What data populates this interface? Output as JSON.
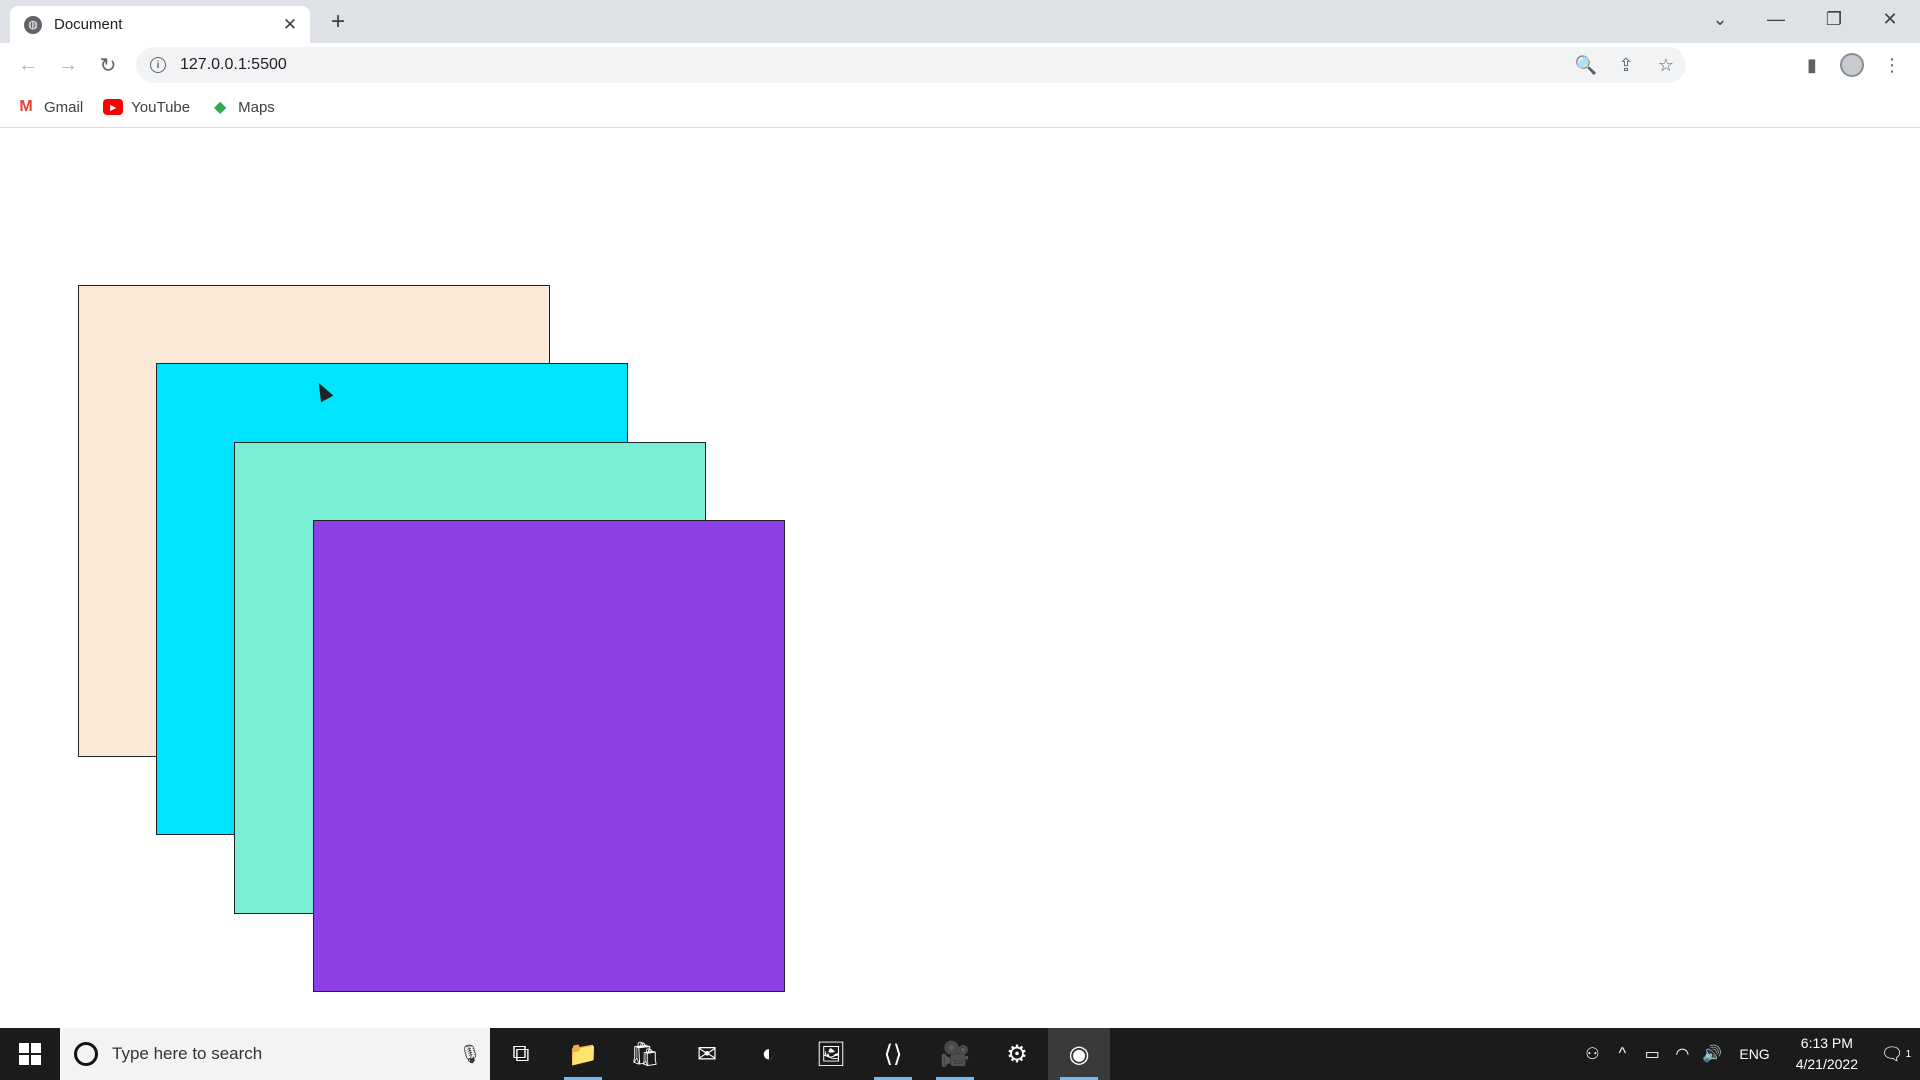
{
  "browser": {
    "tab": {
      "title": "Document",
      "close": "✕"
    },
    "new_tab": "+",
    "window_controls": {
      "tablist": "⌄",
      "minimize": "—",
      "restore": "❐",
      "close": "✕"
    },
    "nav": {
      "back": "←",
      "forward": "→",
      "reload": "↻"
    },
    "address": {
      "url": "127.0.0.1:5500",
      "info_icon": "i"
    },
    "omnibox_icons": {
      "zoom": "🔍",
      "share": "⇪",
      "bookmark": "☆"
    },
    "toolbar_icons": {
      "side_panel": "▮",
      "menu": "⋮"
    },
    "bookmarks": [
      {
        "label": "Gmail",
        "icon": "M"
      },
      {
        "label": "YouTube",
        "icon": "▶"
      },
      {
        "label": "Maps",
        "icon": "◆"
      }
    ]
  },
  "page": {
    "boxes": [
      {
        "name": "box-1",
        "color": "#fbe9d7"
      },
      {
        "name": "box-2",
        "color": "#00e5ff"
      },
      {
        "name": "box-3",
        "color": "#79f0d6"
      },
      {
        "name": "box-4",
        "color": "#8e40e8"
      }
    ]
  },
  "taskbar": {
    "search_placeholder": "Type here to search",
    "mic": "🎙",
    "apps": [
      {
        "name": "task-view",
        "icon": "⧉"
      },
      {
        "name": "file-explorer",
        "icon": "📁"
      },
      {
        "name": "store",
        "icon": "🛍"
      },
      {
        "name": "mail",
        "icon": "✉"
      },
      {
        "name": "edge",
        "icon": "◐"
      },
      {
        "name": "photos",
        "icon": "🖼"
      },
      {
        "name": "vscode",
        "icon": "⟨⟩"
      },
      {
        "name": "zoom",
        "icon": "🎥"
      },
      {
        "name": "settings",
        "icon": "⚙"
      },
      {
        "name": "chrome",
        "icon": "◉"
      }
    ],
    "tray": {
      "people": "⚇",
      "chevron": "^",
      "battery": "▭",
      "wifi": "◠",
      "volume": "🔊",
      "lang": "ENG",
      "time": "6:13 PM",
      "date": "4/21/2022",
      "notifications": "🗨",
      "notif_count": "1"
    }
  }
}
